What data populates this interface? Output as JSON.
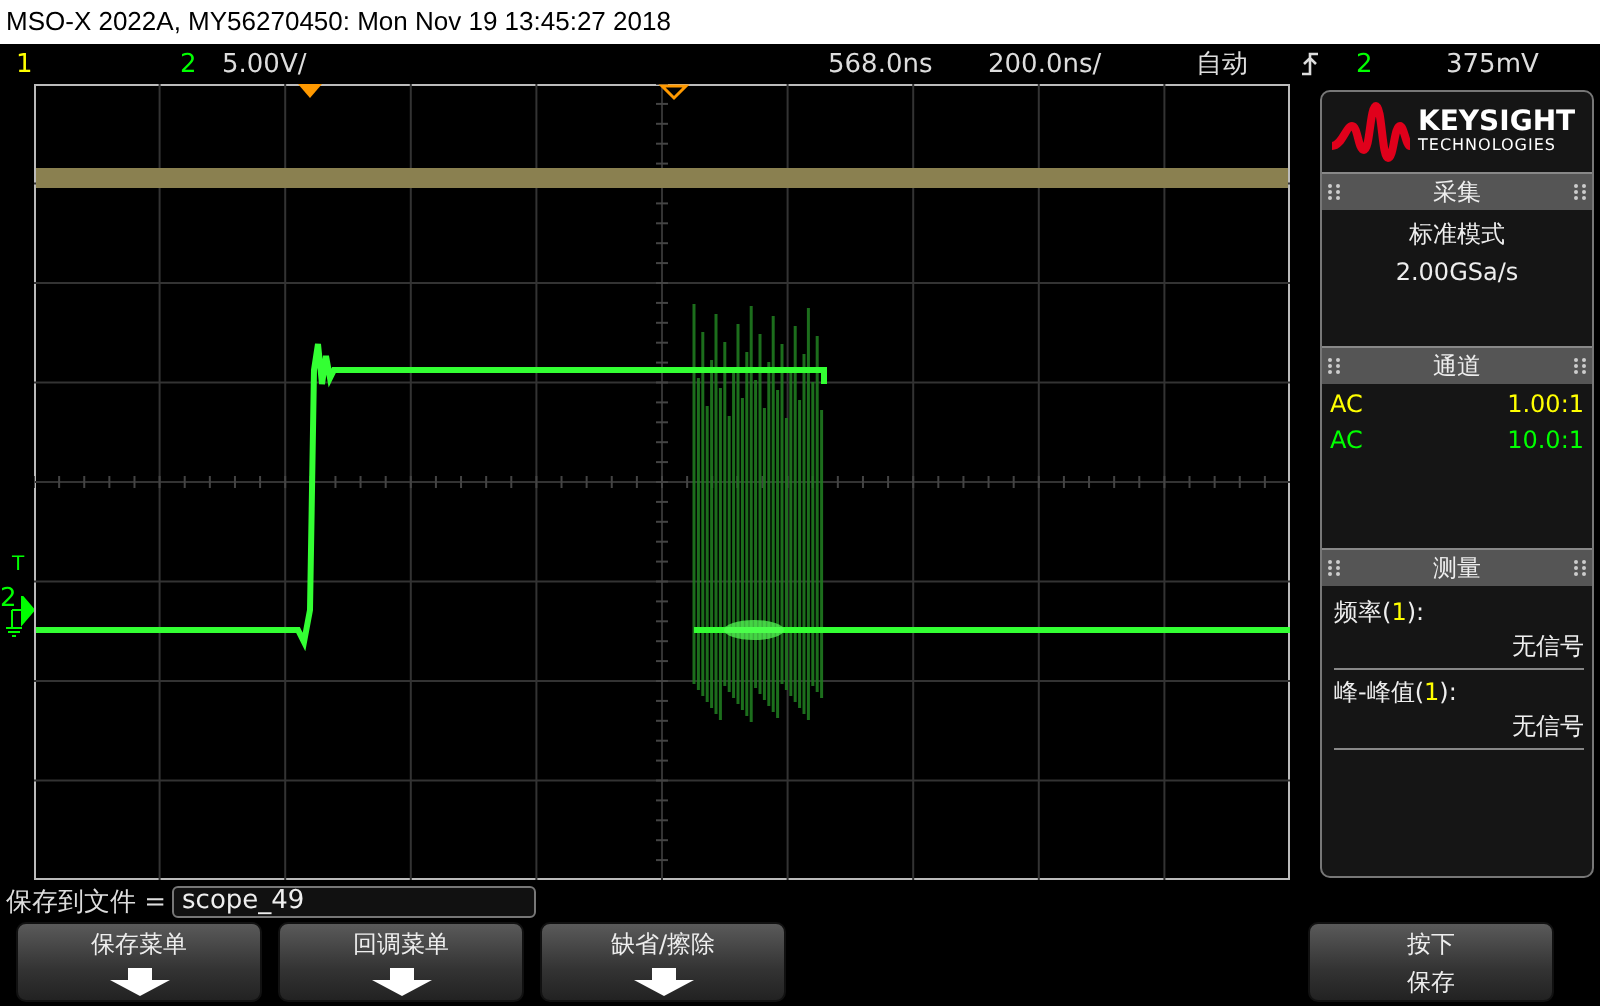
{
  "window": {
    "title": "MSO-X 2022A, MY56270450: Mon Nov 19 13:45:27 2018"
  },
  "status_bar": {
    "channels": [
      {
        "label": "1",
        "color": "#ffff00"
      },
      {
        "label": "2",
        "color": "#00ff00"
      }
    ],
    "scale": "5.00V/",
    "delay": "568.0ns",
    "timebase": "200.0ns/",
    "trigger_mode": "自动",
    "trigger_source": "2",
    "trigger_level": "375mV"
  },
  "graticule": {
    "ground_marker": "2",
    "trigger_marker": "T"
  },
  "panel": {
    "logo": {
      "brand": "KEYSIGHT",
      "sub": "TECHNOLOGIES"
    },
    "acquisition": {
      "title": "采集",
      "mode": "标准模式",
      "rate": "2.00GSa/s"
    },
    "channels": {
      "title": "通道",
      "rows": [
        {
          "coupling": "AC",
          "probe": "1.00:1",
          "color": "#ffff00"
        },
        {
          "coupling": "AC",
          "probe": "10.0:1",
          "color": "#00ff00"
        }
      ]
    },
    "measurements": {
      "title": "测量",
      "rows": [
        {
          "name": "频率(",
          "source": "1",
          "suffix": "):",
          "value": "无信号"
        },
        {
          "name": "峰-峰值(",
          "source": "1",
          "suffix": "):",
          "value": "无信号"
        }
      ]
    }
  },
  "save_field": {
    "label": "保存到文件 =",
    "value": "scope_49"
  },
  "softkeys": [
    {
      "kind": "submenu",
      "label": "保存菜单"
    },
    {
      "kind": "submenu",
      "label": "回调菜单"
    },
    {
      "kind": "submenu",
      "label": "缺省/擦除"
    },
    {
      "kind": "action",
      "label": "按下",
      "sublabel": "保存"
    }
  ]
}
